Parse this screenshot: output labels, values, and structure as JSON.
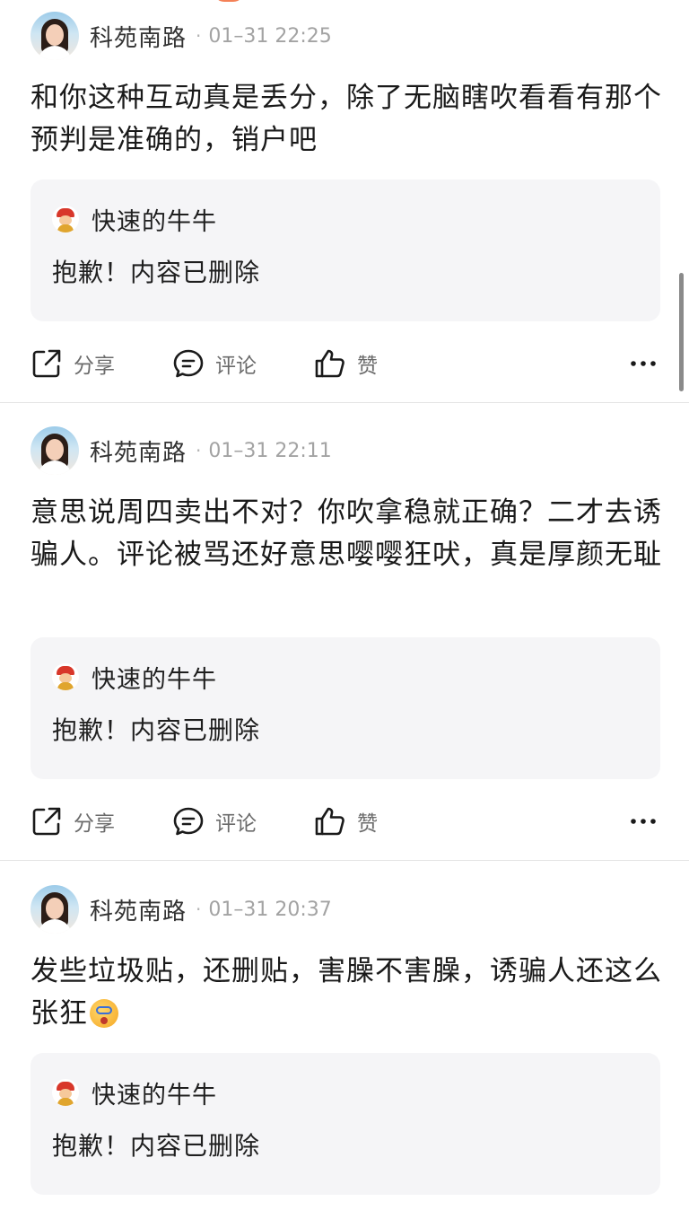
{
  "posts": [
    {
      "user": "科苑南路",
      "separator": "·",
      "time": "01–31 22:25",
      "text": "和你这种互动真是丢分，除了无脑瞎吹看看有那个预判是准确的，销户吧",
      "quote": {
        "user": "快速的牛牛",
        "text": "抱歉！内容已删除"
      }
    },
    {
      "user": "科苑南路",
      "separator": "·",
      "time": "01–31 22:11",
      "text": "意思说周四卖出不对？你吹拿稳就正确？二才去诱骗人。评论被骂还好意思嘤嘤狂吠，真是厚颜无耻",
      "quote": {
        "user": "快速的牛牛",
        "text": "抱歉！内容已删除"
      }
    },
    {
      "user": "科苑南路",
      "separator": "·",
      "time": "01–31 20:37",
      "text": "发些垃圾贴，还删贴，害臊不害臊，诱骗人还这么张狂",
      "quote": {
        "user": "快速的牛牛",
        "text": "抱歉！内容已删除"
      }
    }
  ],
  "actions": {
    "share": "分享",
    "comment": "评论",
    "like": "赞"
  },
  "icons": {
    "share": "share-icon",
    "comment": "comment-icon",
    "like": "thumbs-up-icon",
    "more": "more-dots-icon",
    "emoji": "dizzy-face-emoji"
  }
}
